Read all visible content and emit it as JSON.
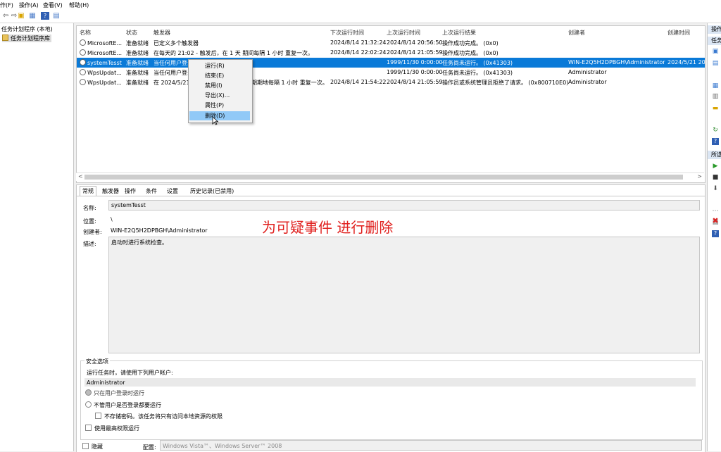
{
  "menubar": {
    "items": [
      "作(F)",
      "操作(A)",
      "查看(V)",
      "帮助(H)"
    ]
  },
  "tree": {
    "root": "任务计划程序 (本地)",
    "library": "任务计划程序库"
  },
  "tasklist": {
    "columns": [
      "名称",
      "状态",
      "触发器",
      "下次运行时间",
      "上次运行时间",
      "上次运行结果",
      "创建者",
      "创建时间"
    ],
    "rows": [
      {
        "name": "MicrosoftE...",
        "status": "准备就绪",
        "trigger": "已定义多个触发器",
        "next": "2024/8/14 21:32:24",
        "last": "2024/8/14 20:56:50",
        "result": "操作成功完成。 (0x0)",
        "author": "",
        "created": ""
      },
      {
        "name": "MicrosoftE...",
        "status": "准备就绪",
        "trigger": "在每天的 21:02 - 触发后，在 1 天 期间每隔 1 小时 重复一次。",
        "next": "2024/8/14 22:02:24",
        "last": "2024/8/14 21:05:59",
        "result": "操作成功完成。 (0x0)",
        "author": "",
        "created": ""
      },
      {
        "name": "systemTesst",
        "status": "准备就绪",
        "trigger": "当任何用户登录",
        "next": "",
        "last": "1999/11/30 0:00:00",
        "result": "任务尚未运行。 (0x41303)",
        "author": "WIN-E2Q5H2DPBGH\\Administrator",
        "created": "2024/5/21 20"
      },
      {
        "name": "WpsUpdat...",
        "status": "准备就绪",
        "trigger": "当任何用户登录",
        "next": "",
        "last": "1999/11/30 0:00:00",
        "result": "任务尚未运行。 (0x41303)",
        "author": "Administrator",
        "created": ""
      },
      {
        "name": "WpsUpdat...",
        "status": "准备就绪",
        "trigger": "在 2024/5/21",
        "trigger_tail": "期期地每隔 1 小时 重复一次。",
        "next": "2024/8/14 21:54:22",
        "last": "2024/8/14 21:05:59",
        "result": "操作员或系统管理员拒绝了请求。 (0x800710E0)",
        "author": "Administrator",
        "created": ""
      }
    ]
  },
  "context_menu": {
    "items": [
      "运行(R)",
      "结束(E)",
      "禁用(I)",
      "导出(X)...",
      "属性(P)",
      "删除(D)"
    ],
    "highlighted_index": 5
  },
  "detail": {
    "tabs": [
      "常规",
      "触发器",
      "操作",
      "条件",
      "设置",
      "历史记录(已禁用)"
    ],
    "name_label": "名称:",
    "name_value": "systemTesst",
    "location_label": "位置:",
    "location_value": "\\",
    "author_label": "创建者:",
    "author_value": "WIN-E2Q5H2DPBGH\\Administrator",
    "description_label": "描述:",
    "description_value": "启动时进行系统检查。",
    "security_title": "安全选项",
    "run_as_label": "运行任务时，请使用下列用户帐户:",
    "run_as_value": "Administrator",
    "opt_logged_on": "只在用户登录时运行",
    "opt_whether": "不管用户是否登录都要运行",
    "opt_no_store": "不存储密码。该任务将只有访问本地资源的权限",
    "opt_highest": "使用最高权限运行",
    "hidden_label": "隐藏",
    "config_label": "配置:",
    "config_value": "Windows Vista™、Windows Server™ 2008"
  },
  "annotation": "为可疑事件  进行删除",
  "actions": {
    "header1": "操作",
    "header2": "任务",
    "header3": "所选"
  }
}
